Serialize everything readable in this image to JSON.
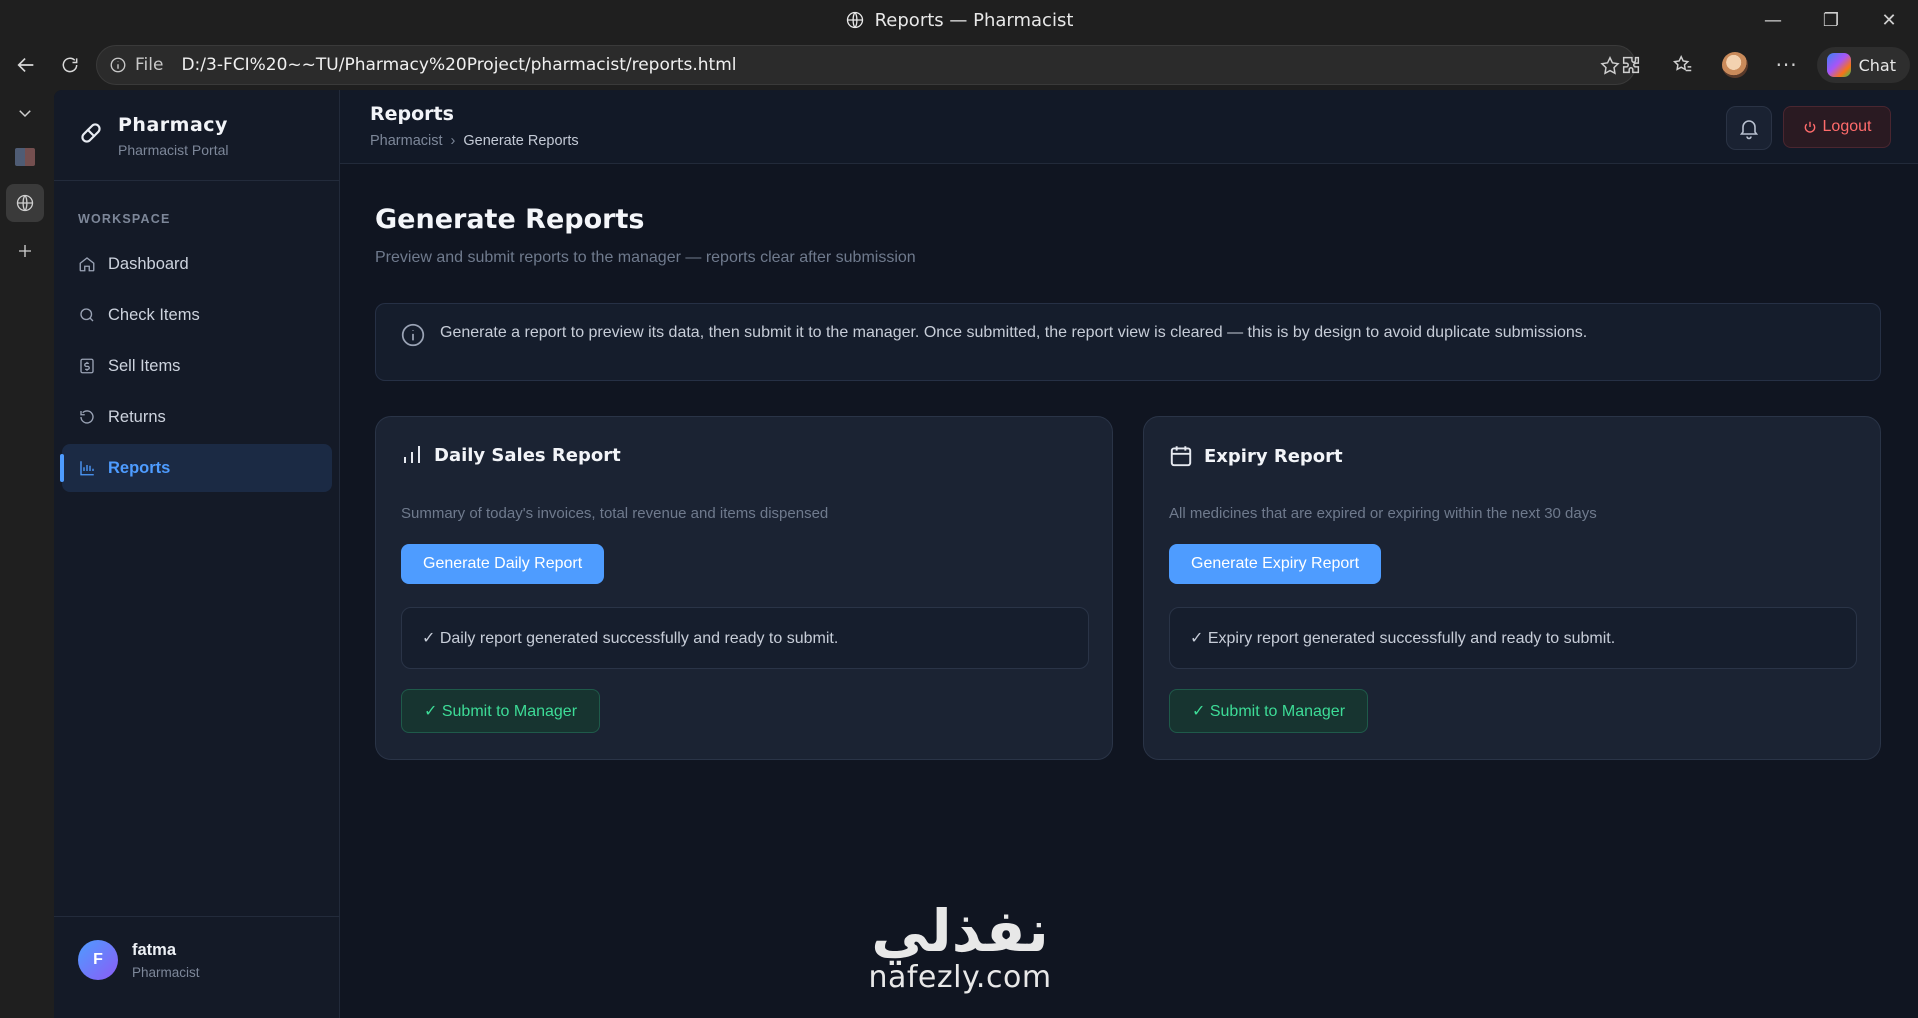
{
  "browser": {
    "window_title": "Reports — Pharmacist",
    "address_prefix": "File",
    "url": "D:/3-FCI%20~~TU/Pharmacy%20Project/pharmacist/reports.html",
    "chat_label": "Chat"
  },
  "sidebar": {
    "brand_name": "Pharmacy",
    "brand_sub": "Pharmacist Portal",
    "section_label": "WORKSPACE",
    "items": [
      {
        "label": "Dashboard",
        "icon": "home-icon"
      },
      {
        "label": "Check Items",
        "icon": "search-icon"
      },
      {
        "label": "Sell Items",
        "icon": "dollar-icon"
      },
      {
        "label": "Returns",
        "icon": "undo-icon"
      },
      {
        "label": "Reports",
        "icon": "bar-chart-icon",
        "active": true
      }
    ],
    "user": {
      "initial": "F",
      "name": "fatma",
      "role": "Pharmacist"
    }
  },
  "topbar": {
    "title": "Reports",
    "breadcrumb_root": "Pharmacist",
    "breadcrumb_sep": "›",
    "breadcrumb_current": "Generate Reports",
    "logout_label": "Logout"
  },
  "main": {
    "title": "Generate Reports",
    "subtitle": "Preview and submit reports to the manager — reports clear after submission",
    "info_text": "Generate a report to preview its data, then submit it to the manager. Once submitted, the report view is cleared — this is by design to avoid duplicate submissions.",
    "cards": [
      {
        "title": "Daily Sales Report",
        "description": "Summary of today's invoices, total revenue and items dispensed",
        "generate_label": "Generate Daily Report",
        "status_text": "✓ Daily report generated successfully and ready to submit.",
        "submit_label": "✓ Submit to Manager"
      },
      {
        "title": "Expiry Report",
        "description": "All medicines that are expired or expiring within the next 30 days",
        "generate_label": "Generate Expiry Report",
        "status_text": "✓ Expiry report generated successfully and ready to submit.",
        "submit_label": "✓ Submit to Manager"
      }
    ]
  },
  "watermark": {
    "arabic": "نفذلي",
    "latin": "nafezly.com"
  },
  "colors": {
    "accent": "#4e9cff",
    "success": "#3ddc97",
    "danger": "#ff6b6b",
    "background": "#101521"
  }
}
